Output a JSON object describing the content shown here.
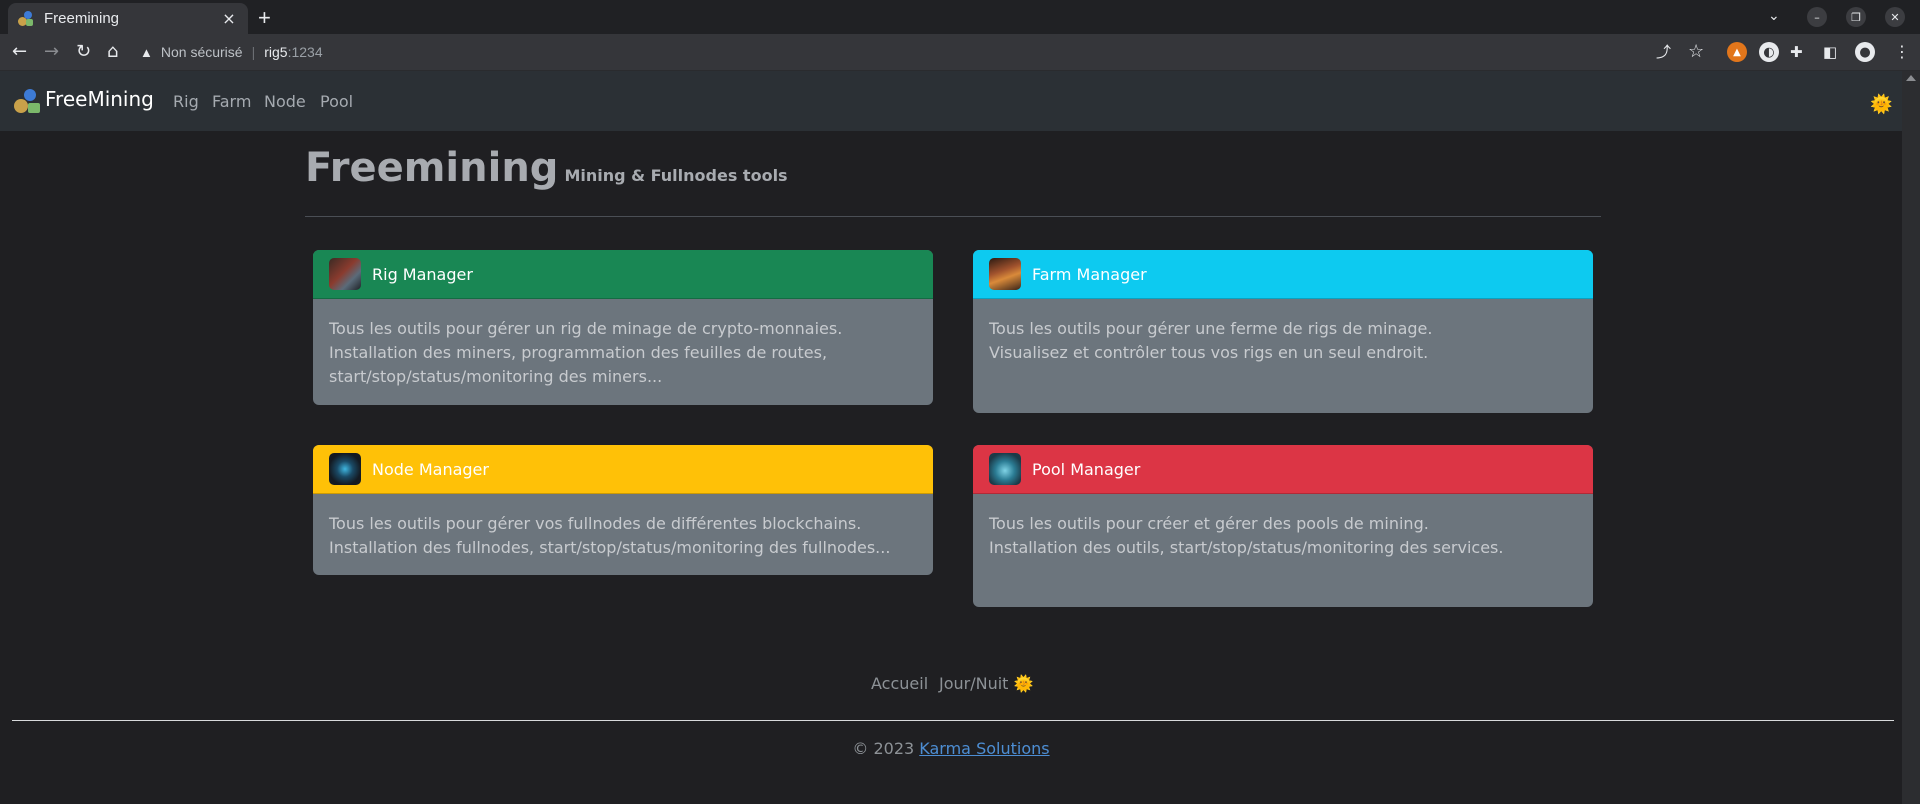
{
  "browser": {
    "tab_title": "Freemining",
    "tab_close": "×",
    "new_tab": "+",
    "search_tabs": "⌄",
    "minimize": "–",
    "restore": "❐",
    "close": "✕",
    "warning_icon": "▲",
    "security_label": "Non sécurisé",
    "url_host": "rig5",
    "url_port": ":1234"
  },
  "navbar": {
    "brand": "FreeMining",
    "links": [
      "Rig",
      "Farm",
      "Node",
      "Pool"
    ],
    "theme_icon": "🌞"
  },
  "header": {
    "title": "Freemining",
    "subtitle": "Mining & Fullnodes tools"
  },
  "cards": [
    {
      "title": "Rig Manager",
      "color": "#198754",
      "lines": [
        "Tous les outils pour gérer un rig de minage de crypto-monnaies.",
        "Installation des miners, programmation des feuilles de routes,",
        "start/stop/status/monitoring des miners..."
      ]
    },
    {
      "title": "Farm Manager",
      "color": "#0dcaf0",
      "lines": [
        "Tous les outils pour gérer une ferme de rigs de minage.",
        "Visualisez et contrôler tous vos rigs en un seul endroit."
      ]
    },
    {
      "title": "Node Manager",
      "color": "#ffc107",
      "lines": [
        "Tous les outils pour gérer vos fullnodes de différentes blockchains.",
        "Installation des fullnodes, start/stop/status/monitoring des fullnodes..."
      ]
    },
    {
      "title": "Pool Manager",
      "color": "#dc3545",
      "lines": [
        "Tous les outils pour créer et gérer des pools de mining.",
        "Installation des outils, start/stop/status/monitoring des services."
      ]
    }
  ],
  "footer": {
    "home_label": "Accueil",
    "daynight_label": "Jour/Nuit",
    "daynight_icon": "🌞",
    "copyright_prefix": "© 2023 ",
    "company": "Karma Solutions"
  }
}
